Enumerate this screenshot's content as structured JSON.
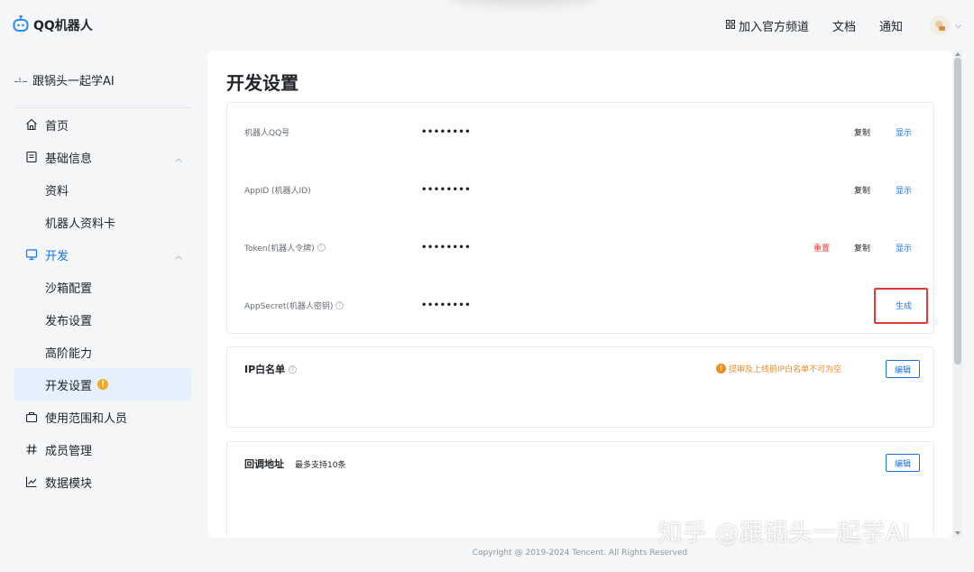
{
  "header": {
    "brand": "QQ机器人",
    "nav": {
      "join_channel": "加入官方频道",
      "docs": "文档",
      "notice": "通知"
    }
  },
  "sidebar": {
    "account": "跟锅头一起学AI",
    "menu": {
      "home": "首页",
      "basic_info": "基础信息",
      "profile": "资料",
      "bot_card": "机器人资料卡",
      "dev": "开发",
      "sandbox": "沙箱配置",
      "publish": "发布设置",
      "advanced": "高阶能力",
      "dev_settings": "开发设置",
      "dev_settings_badge": "!",
      "scope": "使用范围和人员",
      "members": "成员管理",
      "data": "数据模块"
    }
  },
  "main": {
    "title": "开发设置",
    "credentials": {
      "qq": {
        "label": "机器人QQ号",
        "value": "••••••••"
      },
      "appid": {
        "label": "AppID (机器人ID)",
        "value": "••••••••"
      },
      "token": {
        "label": "Token(机器人令牌)",
        "value": "••••••••"
      },
      "secret": {
        "label": "AppSecret(机器人密钥)",
        "value": "••••••••"
      },
      "copy": "复制",
      "show": "显示",
      "reset": "重置",
      "generate": "生成"
    },
    "ip_whitelist": {
      "title": "IP白名单",
      "warning": "提审及上线前IP白名单不可为空",
      "edit": "编辑"
    },
    "callback": {
      "title": "回调地址",
      "subtitle": "最多支持10条",
      "edit": "编辑"
    }
  },
  "footer": "Copyright @ 2019-2024 Tencent. All Rights Reserved",
  "watermark": "知乎 @跟锅头一起学AI",
  "colors": {
    "accent": "#1a73e8",
    "danger": "#e53935",
    "warning": "#f08a24",
    "selected_bg": "#e5f0ff"
  }
}
